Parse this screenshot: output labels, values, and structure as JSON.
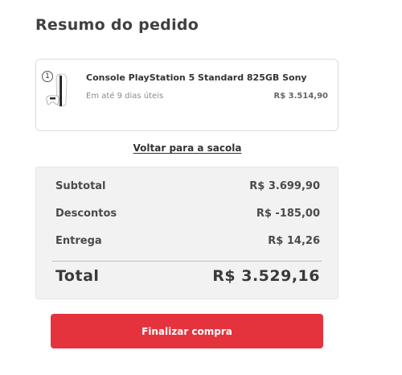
{
  "page": {
    "title": "Resumo do pedido"
  },
  "product": {
    "quantity": "1",
    "name": "Console PlayStation 5 Standard 825GB Sony",
    "delivery": "Em até 9 dias úteis",
    "price": "R$ 3.514,90"
  },
  "back_link": "Voltar para a sacola",
  "summary": {
    "subtotal_label": "Subtotal",
    "subtotal_value": "R$ 3.699,90",
    "discount_label": "Descontos",
    "discount_value": "R$ -185,00",
    "shipping_label": "Entrega",
    "shipping_value": "R$ 14,26",
    "total_label": "Total",
    "total_value": "R$ 3.529,16"
  },
  "checkout_button": "Finalizar compra",
  "colors": {
    "accent": "#e5333d",
    "summary_bg": "#f2f2f2"
  }
}
